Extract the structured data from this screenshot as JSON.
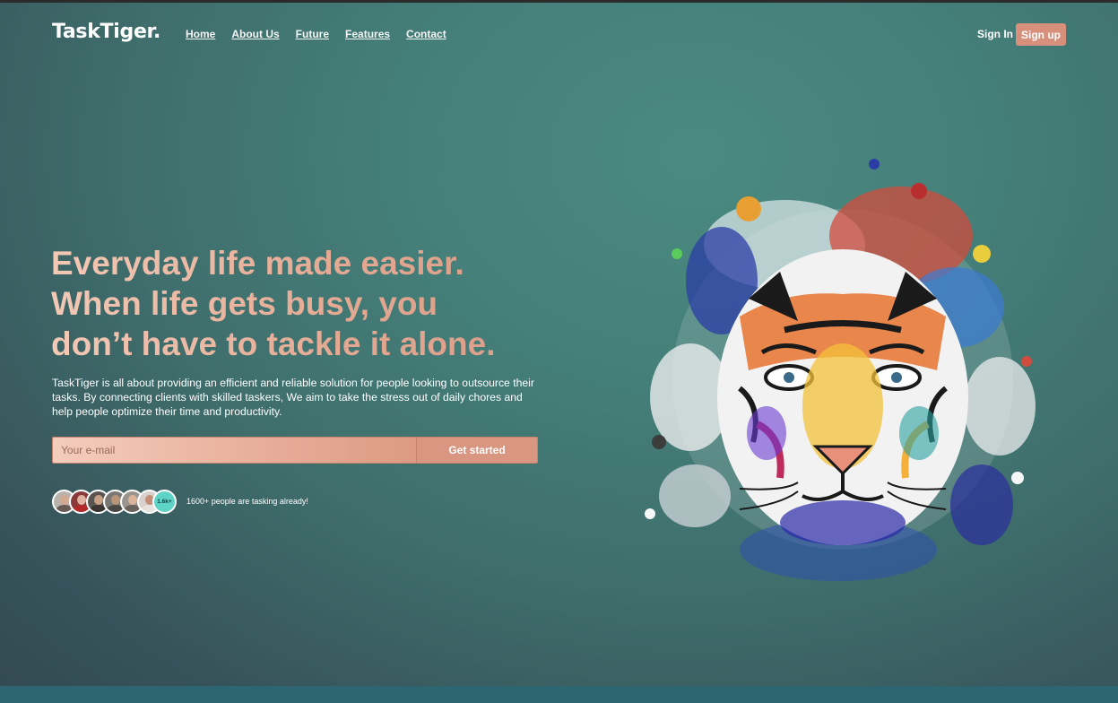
{
  "brand": {
    "logo": "TaskTiger."
  },
  "nav": {
    "links": [
      "Home",
      "About Us",
      "Future",
      "Features",
      "Contact"
    ],
    "signin": "Sign In",
    "signup": "Sign up"
  },
  "hero": {
    "headline": [
      "Everyday life made easier.",
      "When life gets busy, you",
      "don’t have to tackle it alone."
    ],
    "description": "TaskTiger is all about providing an efficient and reliable solution for people looking to outsource their tasks. By connecting clients with skilled taskers, We aim to take the stress out of daily chores and help people optimize their time and productivity.",
    "email_placeholder": "Your e-mail",
    "cta": "Get started",
    "avatar_count": "1.6k+",
    "social_proof": "1600+ people are tasking already!"
  },
  "colors": {
    "accent": "#d6907b",
    "headline_light": "#f3c9b6",
    "headline_dark": "#d99a85",
    "background": "#45807a",
    "badge": "#5ed4c6"
  },
  "icons": {
    "hero_art": "watercolor-tiger-icon"
  }
}
